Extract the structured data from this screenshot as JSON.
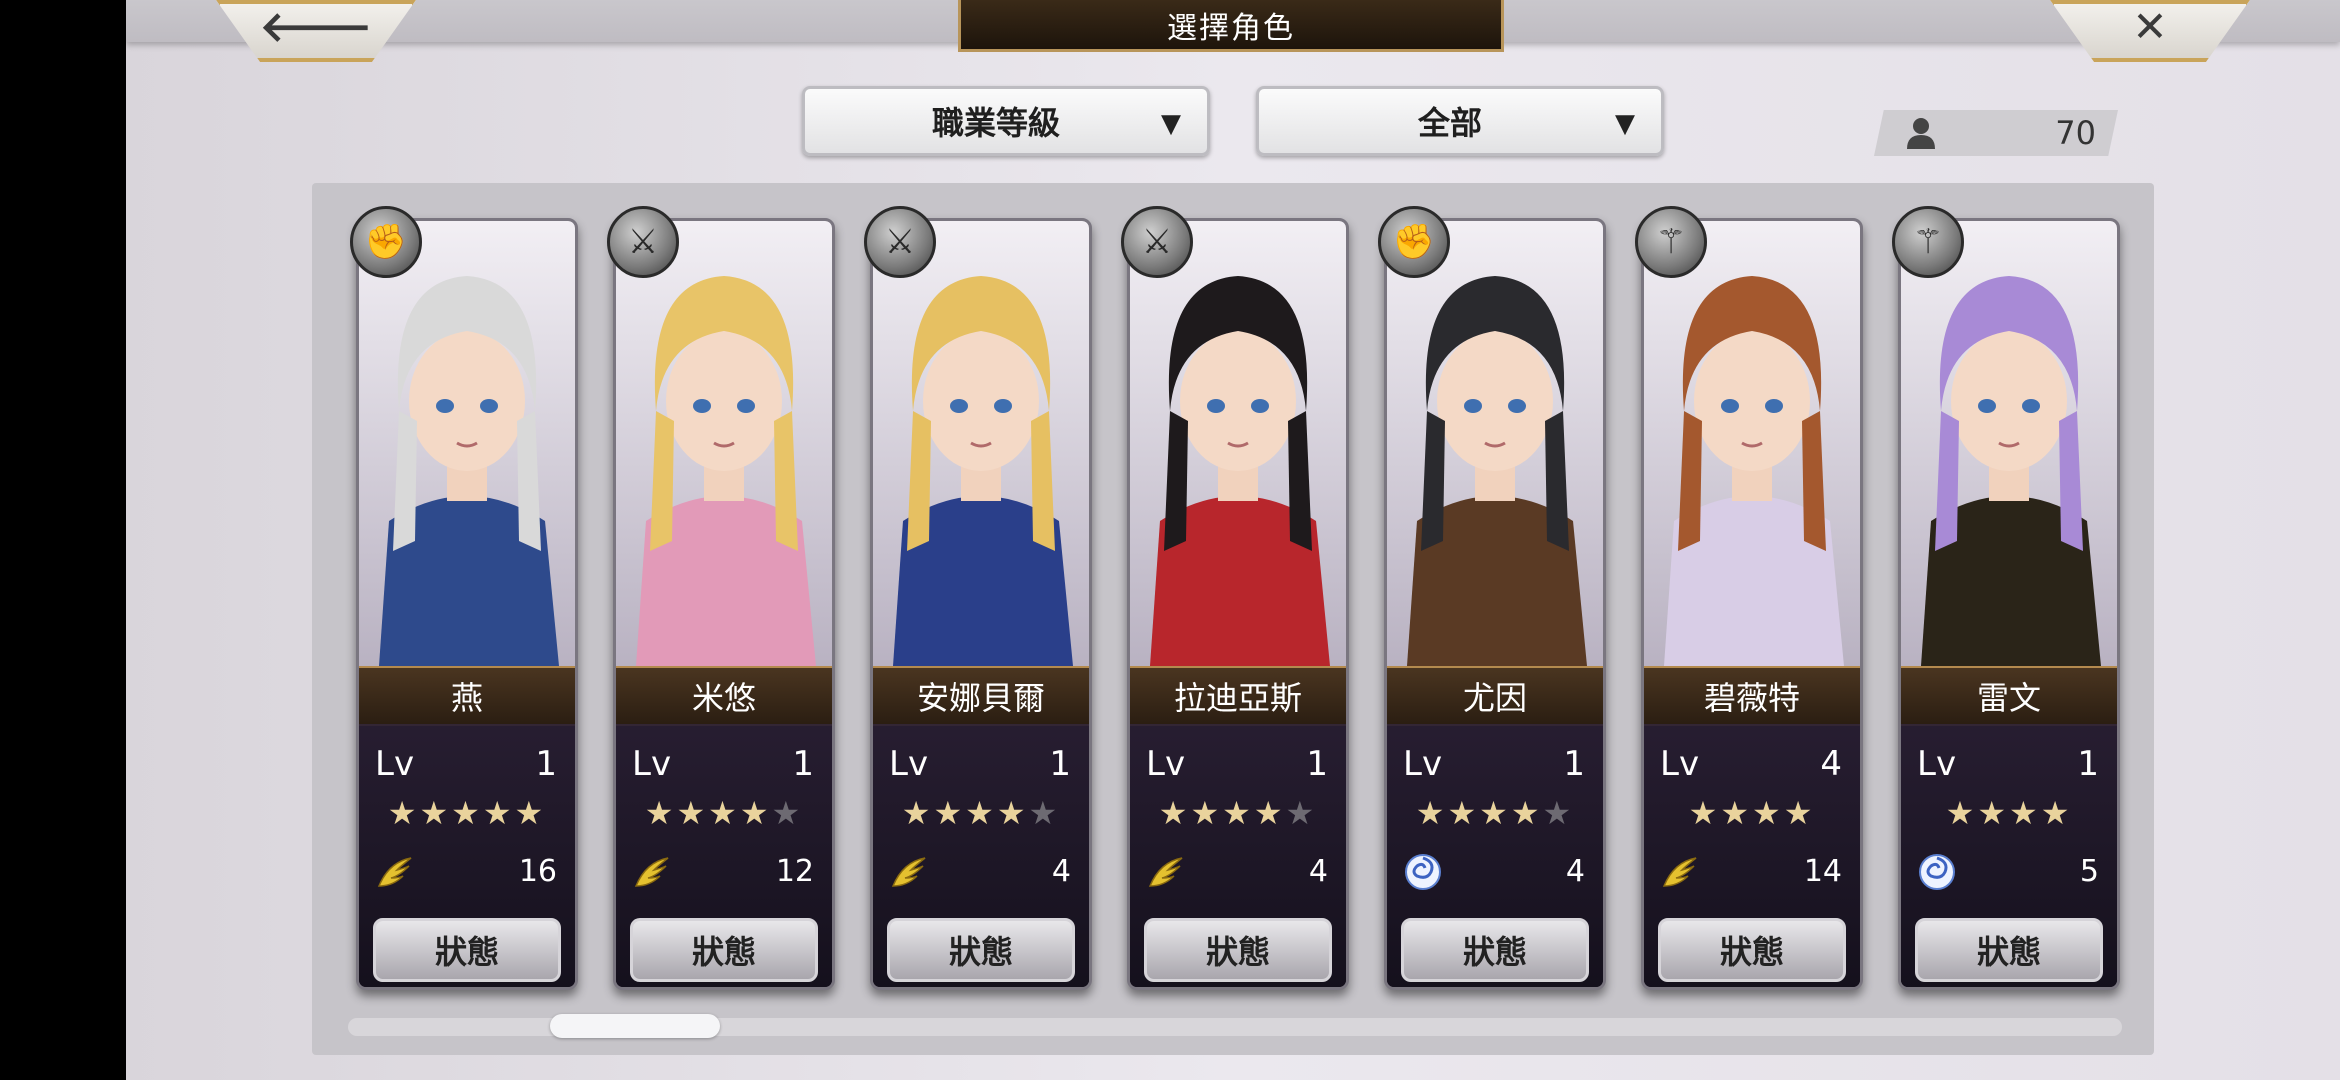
{
  "header": {
    "title": "選擇角色",
    "back_glyph": "🡐",
    "close_glyph": "✕"
  },
  "filters": {
    "sort_label": "職業等級",
    "filter_label": "全部",
    "arrow": "▼"
  },
  "unit_count": "70",
  "colors": {
    "panel": "#c6c4c9",
    "name_plate": "#3a2818",
    "gold_border": "#b48a4e"
  },
  "characters": [
    {
      "name": "燕",
      "lv_label": "Lv",
      "level": "1",
      "stars": 5,
      "max_stars": 5,
      "element_icon": "gold-wing-icon",
      "element_value": "16",
      "status_label": "狀態",
      "class_icon": "fist-icon",
      "hair": "#d9d9d9",
      "outfit": "#2e4a8c"
    },
    {
      "name": "米悠",
      "lv_label": "Lv",
      "level": "1",
      "stars": 4,
      "max_stars": 5,
      "element_icon": "gold-wing-icon",
      "element_value": "12",
      "status_label": "狀態",
      "class_icon": "sword-icon",
      "hair": "#e8c468",
      "outfit": "#e29ab8"
    },
    {
      "name": "安娜貝爾",
      "lv_label": "Lv",
      "level": "1",
      "stars": 4,
      "max_stars": 5,
      "element_icon": "gold-wing-icon",
      "element_value": "4",
      "status_label": "狀態",
      "class_icon": "sword-icon",
      "hair": "#e6c062",
      "outfit": "#2a3f8a"
    },
    {
      "name": "拉迪亞斯",
      "lv_label": "Lv",
      "level": "1",
      "stars": 4,
      "max_stars": 5,
      "element_icon": "gold-wing-icon",
      "element_value": "4",
      "status_label": "狀態",
      "class_icon": "sword-icon",
      "hair": "#1e1a1c",
      "outfit": "#b8262c"
    },
    {
      "name": "尤因",
      "lv_label": "Lv",
      "level": "1",
      "stars": 4,
      "max_stars": 5,
      "element_icon": "blue-swirl-icon",
      "element_value": "4",
      "status_label": "狀態",
      "class_icon": "fist-icon",
      "hair": "#2a2a2e",
      "outfit": "#5a3a24"
    },
    {
      "name": "碧薇特",
      "lv_label": "Lv",
      "level": "4",
      "stars": 4,
      "max_stars": 4,
      "element_icon": "gold-wing-icon",
      "element_value": "14",
      "status_label": "狀態",
      "class_icon": "staff-icon",
      "hair": "#a4582e",
      "outfit": "#d8cde6"
    },
    {
      "name": "雷文",
      "lv_label": "Lv",
      "level": "1",
      "stars": 4,
      "max_stars": 4,
      "element_icon": "blue-swirl-icon",
      "element_value": "5",
      "status_label": "狀態",
      "class_icon": "staff-icon",
      "hair": "#a88ad6",
      "outfit": "#2a2418"
    }
  ]
}
